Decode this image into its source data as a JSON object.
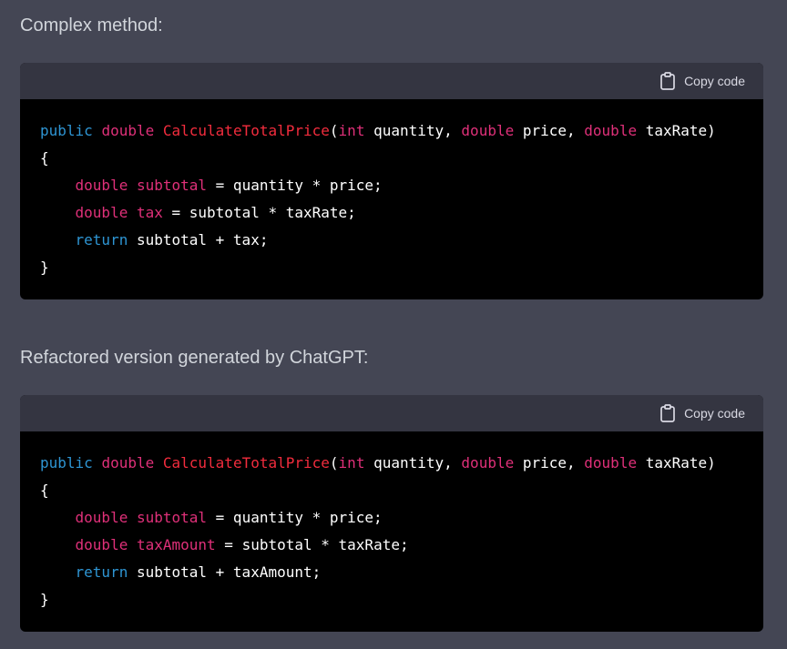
{
  "blocks": [
    {
      "heading": "Complex method:",
      "copy_label": "Copy code",
      "lines": [
        [
          {
            "t": "public",
            "c": "kw-blue"
          },
          {
            "t": " ",
            "c": "pl"
          },
          {
            "t": "double",
            "c": "tp"
          },
          {
            "t": " ",
            "c": "pl"
          },
          {
            "t": "CalculateTotalPrice",
            "c": "fn"
          },
          {
            "t": "(",
            "c": "pl"
          },
          {
            "t": "int",
            "c": "tp"
          },
          {
            "t": " quantity, ",
            "c": "pl"
          },
          {
            "t": "double",
            "c": "tp"
          },
          {
            "t": " price, ",
            "c": "pl"
          },
          {
            "t": "double",
            "c": "tp"
          },
          {
            "t": " taxRate)",
            "c": "pl"
          }
        ],
        [
          {
            "t": "{",
            "c": "pl"
          }
        ],
        [
          {
            "t": "    ",
            "c": "pl"
          },
          {
            "t": "double",
            "c": "tp"
          },
          {
            "t": " ",
            "c": "pl"
          },
          {
            "t": "subtotal",
            "c": "var"
          },
          {
            "t": " = quantity * price;",
            "c": "pl"
          }
        ],
        [
          {
            "t": "    ",
            "c": "pl"
          },
          {
            "t": "double",
            "c": "tp"
          },
          {
            "t": " ",
            "c": "pl"
          },
          {
            "t": "tax",
            "c": "var"
          },
          {
            "t": " = subtotal * taxRate;",
            "c": "pl"
          }
        ],
        [
          {
            "t": "    ",
            "c": "pl"
          },
          {
            "t": "return",
            "c": "kw-blue"
          },
          {
            "t": " subtotal + tax;",
            "c": "pl"
          }
        ],
        [
          {
            "t": "}",
            "c": "pl"
          }
        ]
      ]
    },
    {
      "heading": "Refactored version generated by ChatGPT:",
      "copy_label": "Copy code",
      "lines": [
        [
          {
            "t": "public",
            "c": "kw-blue"
          },
          {
            "t": " ",
            "c": "pl"
          },
          {
            "t": "double",
            "c": "tp"
          },
          {
            "t": " ",
            "c": "pl"
          },
          {
            "t": "CalculateTotalPrice",
            "c": "fn"
          },
          {
            "t": "(",
            "c": "pl"
          },
          {
            "t": "int",
            "c": "tp"
          },
          {
            "t": " quantity, ",
            "c": "pl"
          },
          {
            "t": "double",
            "c": "tp"
          },
          {
            "t": " price, ",
            "c": "pl"
          },
          {
            "t": "double",
            "c": "tp"
          },
          {
            "t": " taxRate)",
            "c": "pl"
          }
        ],
        [
          {
            "t": "{",
            "c": "pl"
          }
        ],
        [
          {
            "t": "    ",
            "c": "pl"
          },
          {
            "t": "double",
            "c": "tp"
          },
          {
            "t": " ",
            "c": "pl"
          },
          {
            "t": "subtotal",
            "c": "var"
          },
          {
            "t": " = quantity * price;",
            "c": "pl"
          }
        ],
        [
          {
            "t": "    ",
            "c": "pl"
          },
          {
            "t": "double",
            "c": "tp"
          },
          {
            "t": " ",
            "c": "pl"
          },
          {
            "t": "taxAmount",
            "c": "var"
          },
          {
            "t": " = subtotal * taxRate;",
            "c": "pl"
          }
        ],
        [
          {
            "t": "    ",
            "c": "pl"
          },
          {
            "t": "return",
            "c": "kw-blue"
          },
          {
            "t": " subtotal + taxAmount;",
            "c": "pl"
          }
        ],
        [
          {
            "t": "}",
            "c": "pl"
          }
        ]
      ]
    }
  ],
  "icons": {
    "copy": "clipboard-icon"
  },
  "colors": {
    "page_background": "#444654",
    "code_header_background": "#343541",
    "code_background": "#000000",
    "keyword_blue": "#2e95d3",
    "type_pink": "#df3079",
    "function_red": "#f22c3d",
    "plain_text": "#ffffff"
  }
}
